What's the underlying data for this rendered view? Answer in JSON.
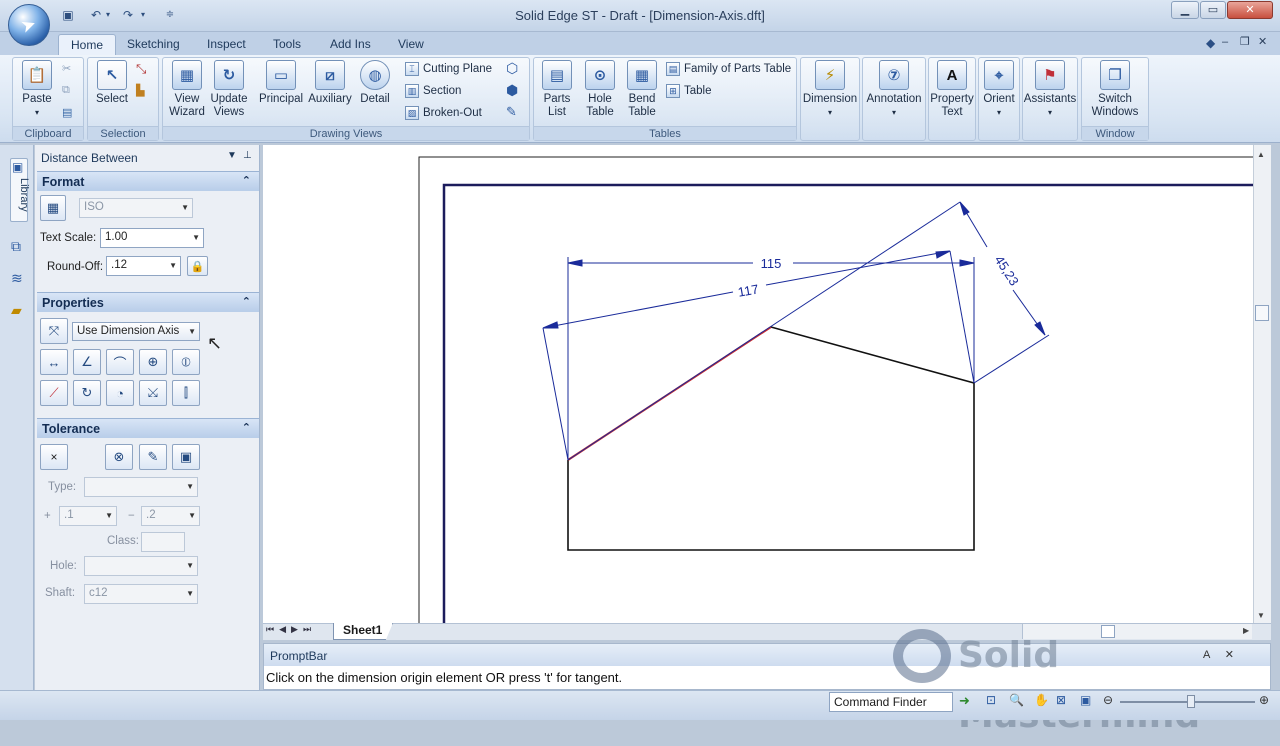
{
  "window": {
    "title": "Solid Edge ST - Draft - [Dimension-Axis.dft]"
  },
  "tabs": [
    "Home",
    "Sketching",
    "Inspect",
    "Tools",
    "Add Ins",
    "View"
  ],
  "ribbon": {
    "clipboard": {
      "label": "Clipboard",
      "paste": "Paste"
    },
    "selection": {
      "label": "Selection",
      "select": "Select"
    },
    "drawing_views": {
      "label": "Drawing Views",
      "view_wizard": "View Wizard",
      "update_views": "Update Views",
      "principal": "Principal",
      "auxiliary": "Auxiliary",
      "detail": "Detail",
      "cutting_plane": "Cutting Plane",
      "section": "Section",
      "broken_out": "Broken-Out"
    },
    "tables": {
      "label": "Tables",
      "parts_list": "Parts List",
      "hole_table": "Hole Table",
      "bend_table": "Bend Table",
      "family_of_parts": "Family of Parts Table",
      "table": "Table"
    },
    "dimension": "Dimension",
    "annotation": "Annotation",
    "property_text": "Property Text",
    "orient": "Orient",
    "assistants": "Assistants",
    "window": {
      "label": "Window",
      "switch_windows": "Switch Windows"
    }
  },
  "left_strip": {
    "library": "Library"
  },
  "panel": {
    "title": "Distance Between",
    "format": {
      "header": "Format",
      "style": "ISO",
      "text_scale_label": "Text Scale:",
      "text_scale": "1.00",
      "round_off_label": "Round-Off:",
      "round_off": ".12"
    },
    "properties": {
      "header": "Properties",
      "axis_mode": "Use Dimension Axis"
    },
    "tolerance": {
      "header": "Tolerance",
      "clear": "×",
      "type_label": "Type:",
      "plus_sign": "+",
      "plus_value": ".1",
      "minus_sign": "−",
      "minus_value": ".2",
      "class_label": "Class:",
      "hole_label": "Hole:",
      "shaft_label": "Shaft:",
      "shaft_value": "c12"
    }
  },
  "drawing": {
    "dim_horizontal": "115",
    "dim_aligned": "117",
    "dim_axis": "45,23",
    "accent": "#cc2a2a",
    "dim_color": "#1a2b9a"
  },
  "sheet_tab": "Sheet1",
  "promptbar": {
    "title": "PromptBar",
    "message": "Click on the dimension origin element  OR press 't' for tangent."
  },
  "status": {
    "command_finder": "Command Finder"
  },
  "watermark": "Solid Mastermind"
}
